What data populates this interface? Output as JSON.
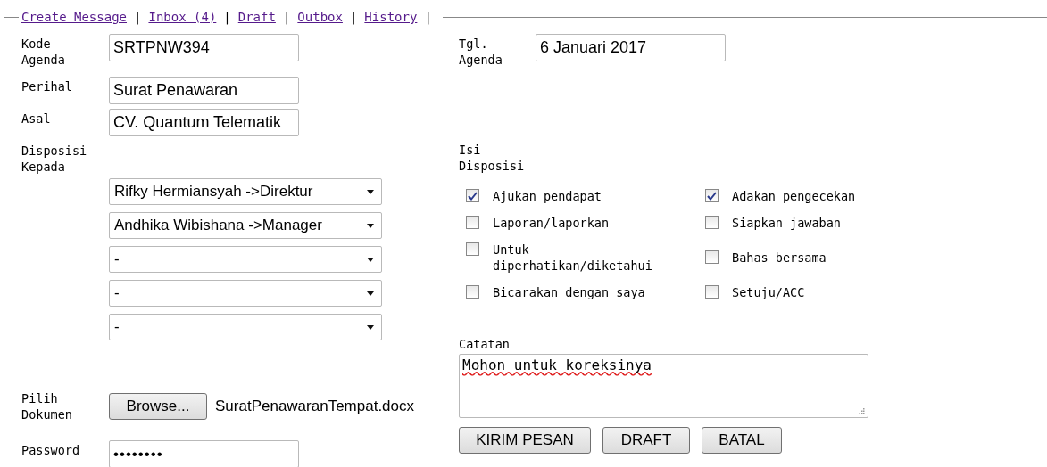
{
  "nav": [
    {
      "label": "Create Message"
    },
    {
      "label": "Inbox (4)"
    },
    {
      "label": "Draft"
    },
    {
      "label": "Outbox"
    },
    {
      "label": "History"
    }
  ],
  "separator": "|",
  "fields": [
    {
      "label": "Kode Agenda",
      "value": "SRTPNW394"
    },
    {
      "label": "Perihal",
      "value": "Surat Penawaran"
    },
    {
      "label": "Asal",
      "value": "CV. Quantum Telematik"
    }
  ],
  "tgl_agenda": {
    "label": "Tgl. Agenda",
    "value": "6 Januari 2017"
  },
  "disposisi_kepada": {
    "label": "Disposisi Kepada",
    "selects": [
      {
        "value": "Rifky Hermiansyah ->Direktur"
      },
      {
        "value": "Andhika Wibishana ->Manager"
      },
      {
        "value": "-"
      },
      {
        "value": "-"
      },
      {
        "value": "-"
      }
    ]
  },
  "isi_disposisi": {
    "label": "Isi Disposisi",
    "options": [
      {
        "label": "Ajukan pendapat",
        "checked": true
      },
      {
        "label": "Adakan pengecekan",
        "checked": true
      },
      {
        "label": "Laporan/laporkan",
        "checked": false
      },
      {
        "label": "Siapkan jawaban",
        "checked": false
      },
      {
        "label": "Untuk diperhatikan/diketahui",
        "checked": false
      },
      {
        "label": "Bahas bersama",
        "checked": false
      },
      {
        "label": "Bicarakan dengan saya",
        "checked": false
      },
      {
        "label": "Setuju/ACC",
        "checked": false
      }
    ]
  },
  "catatan": {
    "label": "Catatan",
    "value": "Mohon untuk koreksinya"
  },
  "dokumen": {
    "label": "Pilih Dokumen",
    "button": "Browse...",
    "file": "SuratPenawaranTempat.docx"
  },
  "password": {
    "label": "Password",
    "value": "••••••••"
  },
  "buttons": [
    {
      "label": "KIRIM PESAN"
    },
    {
      "label": "DRAFT"
    },
    {
      "label": "BATAL"
    }
  ]
}
